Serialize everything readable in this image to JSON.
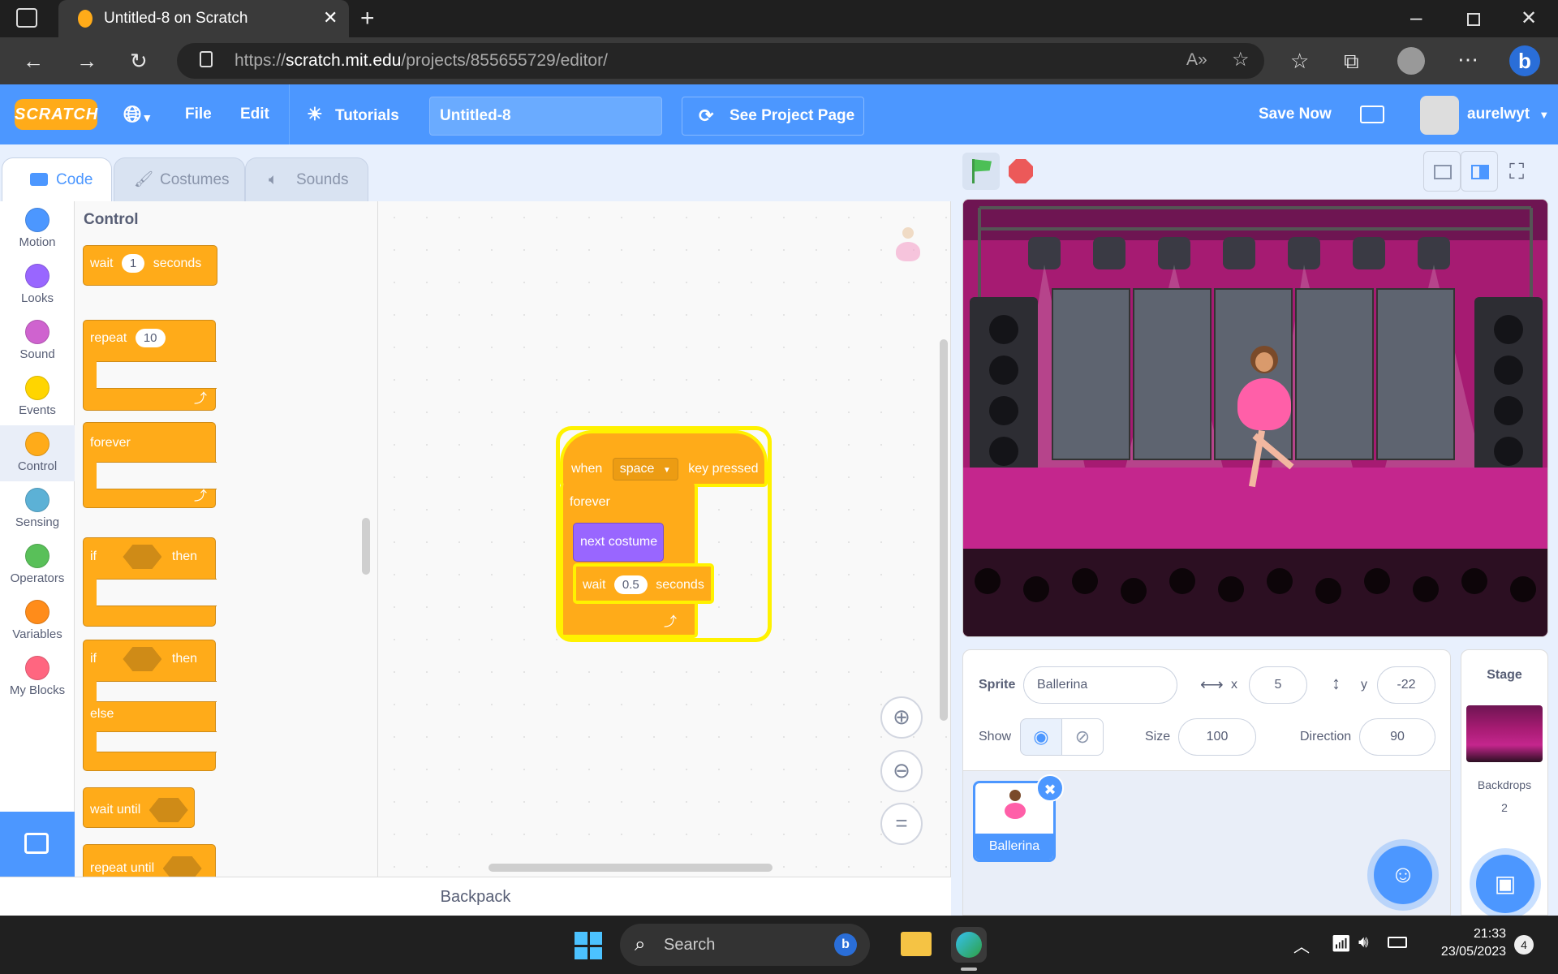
{
  "browser": {
    "tab_title": "Untitled-8 on Scratch",
    "url": "https://scratch.mit.edu/projects/855655729/editor/",
    "url_host": "scratch.mit.edu",
    "url_path": "/projects/855655729/editor/"
  },
  "menubar": {
    "logo": "SCRATCH",
    "file": "File",
    "edit": "Edit",
    "tutorials": "Tutorials",
    "project_title": "Untitled-8",
    "see_project": "See Project Page",
    "save_now": "Save Now",
    "username": "aurelwyt"
  },
  "editor_tabs": [
    "Code",
    "Costumes",
    "Sounds"
  ],
  "categories": [
    {
      "label": "Motion",
      "color": "#4c97ff"
    },
    {
      "label": "Looks",
      "color": "#9966ff"
    },
    {
      "label": "Sound",
      "color": "#cf63cf"
    },
    {
      "label": "Events",
      "color": "#ffd500"
    },
    {
      "label": "Control",
      "color": "#ffab19"
    },
    {
      "label": "Sensing",
      "color": "#5cb1d6"
    },
    {
      "label": "Operators",
      "color": "#59c059"
    },
    {
      "label": "Variables",
      "color": "#ff8c1a"
    },
    {
      "label": "My Blocks",
      "color": "#ff6680"
    }
  ],
  "palette": {
    "heading": "Control",
    "wait": {
      "pre": "wait",
      "value": "1",
      "post": "seconds"
    },
    "repeat": {
      "pre": "repeat",
      "value": "10"
    },
    "forever": "forever",
    "if_then": {
      "pre": "if",
      "post": "then"
    },
    "if_else": {
      "pre": "if",
      "post": "then",
      "else": "else"
    },
    "wait_until": "wait until",
    "repeat_until": "repeat until"
  },
  "script": {
    "hat": {
      "pre": "when",
      "key": "space",
      "post": "key pressed"
    },
    "forever": "forever",
    "next_costume": "next costume",
    "wait": {
      "pre": "wait",
      "value": "0.5",
      "post": "seconds"
    }
  },
  "backpack": "Backpack",
  "sprite_info": {
    "sprite_label": "Sprite",
    "sprite_name": "Ballerina",
    "x_label": "x",
    "x": "5",
    "y_label": "y",
    "y": "-22",
    "show_label": "Show",
    "size_label": "Size",
    "size": "100",
    "direction_label": "Direction",
    "direction": "90"
  },
  "sprites": [
    {
      "name": "Ballerina"
    }
  ],
  "stage_pane": {
    "title": "Stage",
    "backdrops_label": "Backdrops",
    "backdrops_count": "2"
  },
  "taskbar": {
    "search": "Search",
    "time": "21:33",
    "date": "23/05/2023",
    "notifications": "4"
  }
}
